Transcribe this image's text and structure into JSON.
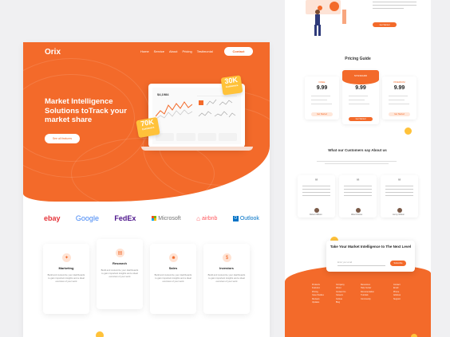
{
  "colors": {
    "accent": "#f36a2a",
    "yellow": "#ffc23a",
    "background": "#f0f0f2"
  },
  "header": {
    "logo": "Orix",
    "nav": [
      "Home",
      "Service",
      "About",
      "Pricing",
      "Testimonial"
    ],
    "contact": "Contact"
  },
  "hero": {
    "title": "Market Intelligence Solutions toTrack your market share",
    "cta": "See all features",
    "badge_top": {
      "value": "30K",
      "label": "Customers"
    },
    "badge_left": {
      "value": "70K",
      "label": "Customers"
    },
    "dashboard_value": "$4,1984"
  },
  "brands": [
    {
      "name": "ebay",
      "icon": "ebay-logo"
    },
    {
      "name": "Google",
      "icon": "google-logo"
    },
    {
      "name": "FedEx",
      "icon": "fedex-logo"
    },
    {
      "name": "Microsoft",
      "icon": "microsoft-logo"
    },
    {
      "name": "airbnb",
      "icon": "airbnb-logo"
    },
    {
      "name": "Outlook",
      "icon": "outlook-logo"
    }
  ],
  "services": [
    {
      "title": "Marketing",
      "icon": "megaphone-icon",
      "desc": "Build and customize your dashboards to gain important insights and a ideal overview of your work"
    },
    {
      "title": "Research",
      "icon": "document-icon",
      "desc": "Build and customize your dashboards to gain important insights and a ideal overview of your work"
    },
    {
      "title": "Sales",
      "icon": "people-icon",
      "desc": "Build and customize your dashboards to gain important insights and a ideal overview of your work"
    },
    {
      "title": "Investors",
      "icon": "money-bag-icon",
      "desc": "Build and customize your dashboards to gain important insights and a ideal overview of your work"
    }
  ],
  "pricing": {
    "title": "Pricing Guide",
    "plans": [
      {
        "name": "FREE",
        "price": "9.99",
        "button": "Get Started"
      },
      {
        "name": "STANDARD",
        "price": "9.99",
        "button": "Get Started"
      },
      {
        "name": "PREMIUM",
        "price": "9.99",
        "button": "Get Started"
      }
    ]
  },
  "top_section": {
    "button": "Get Started"
  },
  "testimonials": {
    "title": "What our Customers say About us",
    "people": [
      "Robert Wilson",
      "Albert Flores",
      "Jenny Wilson"
    ]
  },
  "subscribe": {
    "title": "Take Your Market Intelligence to The Next Level",
    "placeholder": "Enter your email",
    "button": "Subscribe"
  },
  "footer": {
    "columns": [
      [
        "Products",
        "Features",
        "Pricing",
        "Case Studies",
        "Reviews",
        "Updates"
      ],
      [
        "Company",
        "About",
        "Contact Us",
        "Careers",
        "Culture",
        "Blog"
      ],
      [
        "Resources",
        "Help Center",
        "Documentation",
        "Tutorials",
        "Community"
      ],
      [
        "Contact",
        "Email",
        "Phone",
        "Address",
        "Support"
      ]
    ]
  }
}
